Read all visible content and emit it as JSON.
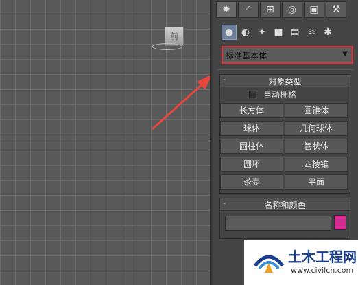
{
  "viewport": {
    "cube_label": "前"
  },
  "command_panel": {
    "tabs": [
      {
        "icon": "create-icon",
        "glyph": "✸"
      },
      {
        "icon": "modify-icon",
        "glyph": "◜"
      },
      {
        "icon": "hierarchy-icon",
        "glyph": "⊞"
      },
      {
        "icon": "motion-icon",
        "glyph": "◎"
      },
      {
        "icon": "display-icon",
        "glyph": "▣"
      },
      {
        "icon": "utilities-icon",
        "glyph": "⚒"
      }
    ],
    "subcategories": [
      {
        "icon": "geometry-icon",
        "glyph": "●"
      },
      {
        "icon": "shapes-icon",
        "glyph": "◐"
      },
      {
        "icon": "lights-icon",
        "glyph": "✦"
      },
      {
        "icon": "cameras-icon",
        "glyph": "■"
      },
      {
        "icon": "helpers-icon",
        "glyph": "▤"
      },
      {
        "icon": "spacewarps-icon",
        "glyph": "≋"
      },
      {
        "icon": "systems-icon",
        "glyph": "✱"
      }
    ],
    "dropdown_value": "标准基本体",
    "object_type": {
      "title": "对象类型",
      "collapse": "-",
      "autogrid_label": "自动栅格",
      "buttons": [
        "长方体",
        "圆锥体",
        "球体",
        "几何球体",
        "圆柱体",
        "管状体",
        "圆环",
        "四棱锥",
        "茶壶",
        "平面"
      ]
    },
    "name_color": {
      "title": "名称和颜色",
      "collapse": "-",
      "name_value": "",
      "color": "#d62b94"
    }
  },
  "watermark": {
    "brand": "土木工程网",
    "url": "www.civilcn.com"
  }
}
